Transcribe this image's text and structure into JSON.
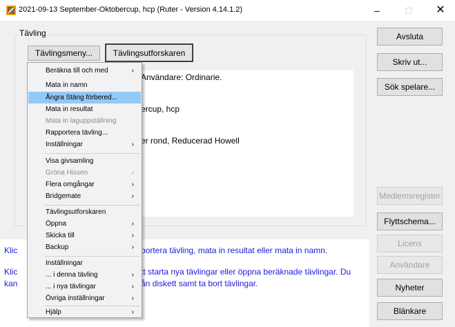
{
  "window": {
    "title": "2021-09-13 September-Oktobercup, hcp  (Ruter - Version 4.14.1.2)",
    "minimize_label": "–",
    "maximize_label": "□",
    "close_label": "✕",
    "accent": "#1a1adc"
  },
  "group": {
    "label": "Tävling",
    "menu_button": "Tävlingsmeny...",
    "explorer_button": "Tävlingsutforskaren"
  },
  "info": {
    "line1": "Användare: Ordinarie.",
    "line2": "ercup, hcp",
    "line3": "er rond, Reducerad Howell"
  },
  "help": {
    "line1_left": "Klic",
    "line1_right": "portera tävling, mata in resultat eller mata in namn.",
    "line2_left": "Klic",
    "line2_right": "tt starta nya tävlingar eller öppna beräknade tävlingar. Du",
    "line3_left": "kan",
    "line3_right": "ån diskett samt ta bort tävlingar."
  },
  "right_buttons": {
    "avsluta": "Avsluta",
    "skriv_ut": "Skriv ut...",
    "sok_spelare": "Sök spelare...",
    "medlemsregister": "Medlemsregister",
    "flyttschema": "Flyttschema...",
    "licens": "Licens",
    "anvandare": "Användare",
    "nyheter": "Nyheter",
    "blankare": "Blänkare"
  },
  "menu": {
    "items": [
      {
        "label": "Beräkna till och med",
        "submenu": true,
        "disabled": false,
        "selected": false
      },
      {
        "label": "Mata in namn",
        "submenu": false,
        "disabled": false,
        "selected": false
      },
      {
        "label": "Ångra Stäng förbered...",
        "submenu": false,
        "disabled": false,
        "selected": true
      },
      {
        "label": "Mata in resultat",
        "submenu": false,
        "disabled": false,
        "selected": false
      },
      {
        "label": "Mata in laguppställning",
        "submenu": false,
        "disabled": true,
        "selected": false
      },
      {
        "label": "Rapportera tävling...",
        "submenu": false,
        "disabled": false,
        "selected": false
      },
      {
        "label": "Inställningar",
        "submenu": true,
        "disabled": false,
        "selected": false
      },
      {
        "label": "Visa givsamling",
        "submenu": false,
        "disabled": false,
        "selected": false
      },
      {
        "label": "Gröna Hissen",
        "submenu": true,
        "disabled": true,
        "selected": false
      },
      {
        "label": "Flera omgångar",
        "submenu": true,
        "disabled": false,
        "selected": false
      },
      {
        "label": "Bridgemate",
        "submenu": true,
        "disabled": false,
        "selected": false
      },
      {
        "label": "Tävlingsutforskaren",
        "submenu": false,
        "disabled": false,
        "selected": false
      },
      {
        "label": "Öppna",
        "submenu": true,
        "disabled": false,
        "selected": false
      },
      {
        "label": "Skicka till",
        "submenu": true,
        "disabled": false,
        "selected": false
      },
      {
        "label": "Backup",
        "submenu": true,
        "disabled": false,
        "selected": false
      },
      {
        "label": "Inställningar",
        "submenu": false,
        "disabled": false,
        "selected": false
      },
      {
        "label": "... i denna tävling",
        "submenu": true,
        "disabled": false,
        "selected": false
      },
      {
        "label": "... i nya tävlingar",
        "submenu": true,
        "disabled": false,
        "selected": false
      },
      {
        "label": "Övriga inställningar",
        "submenu": true,
        "disabled": false,
        "selected": false
      },
      {
        "label": "Hjälp",
        "submenu": true,
        "disabled": false,
        "selected": false
      }
    ],
    "arrow_glyph": "›"
  }
}
